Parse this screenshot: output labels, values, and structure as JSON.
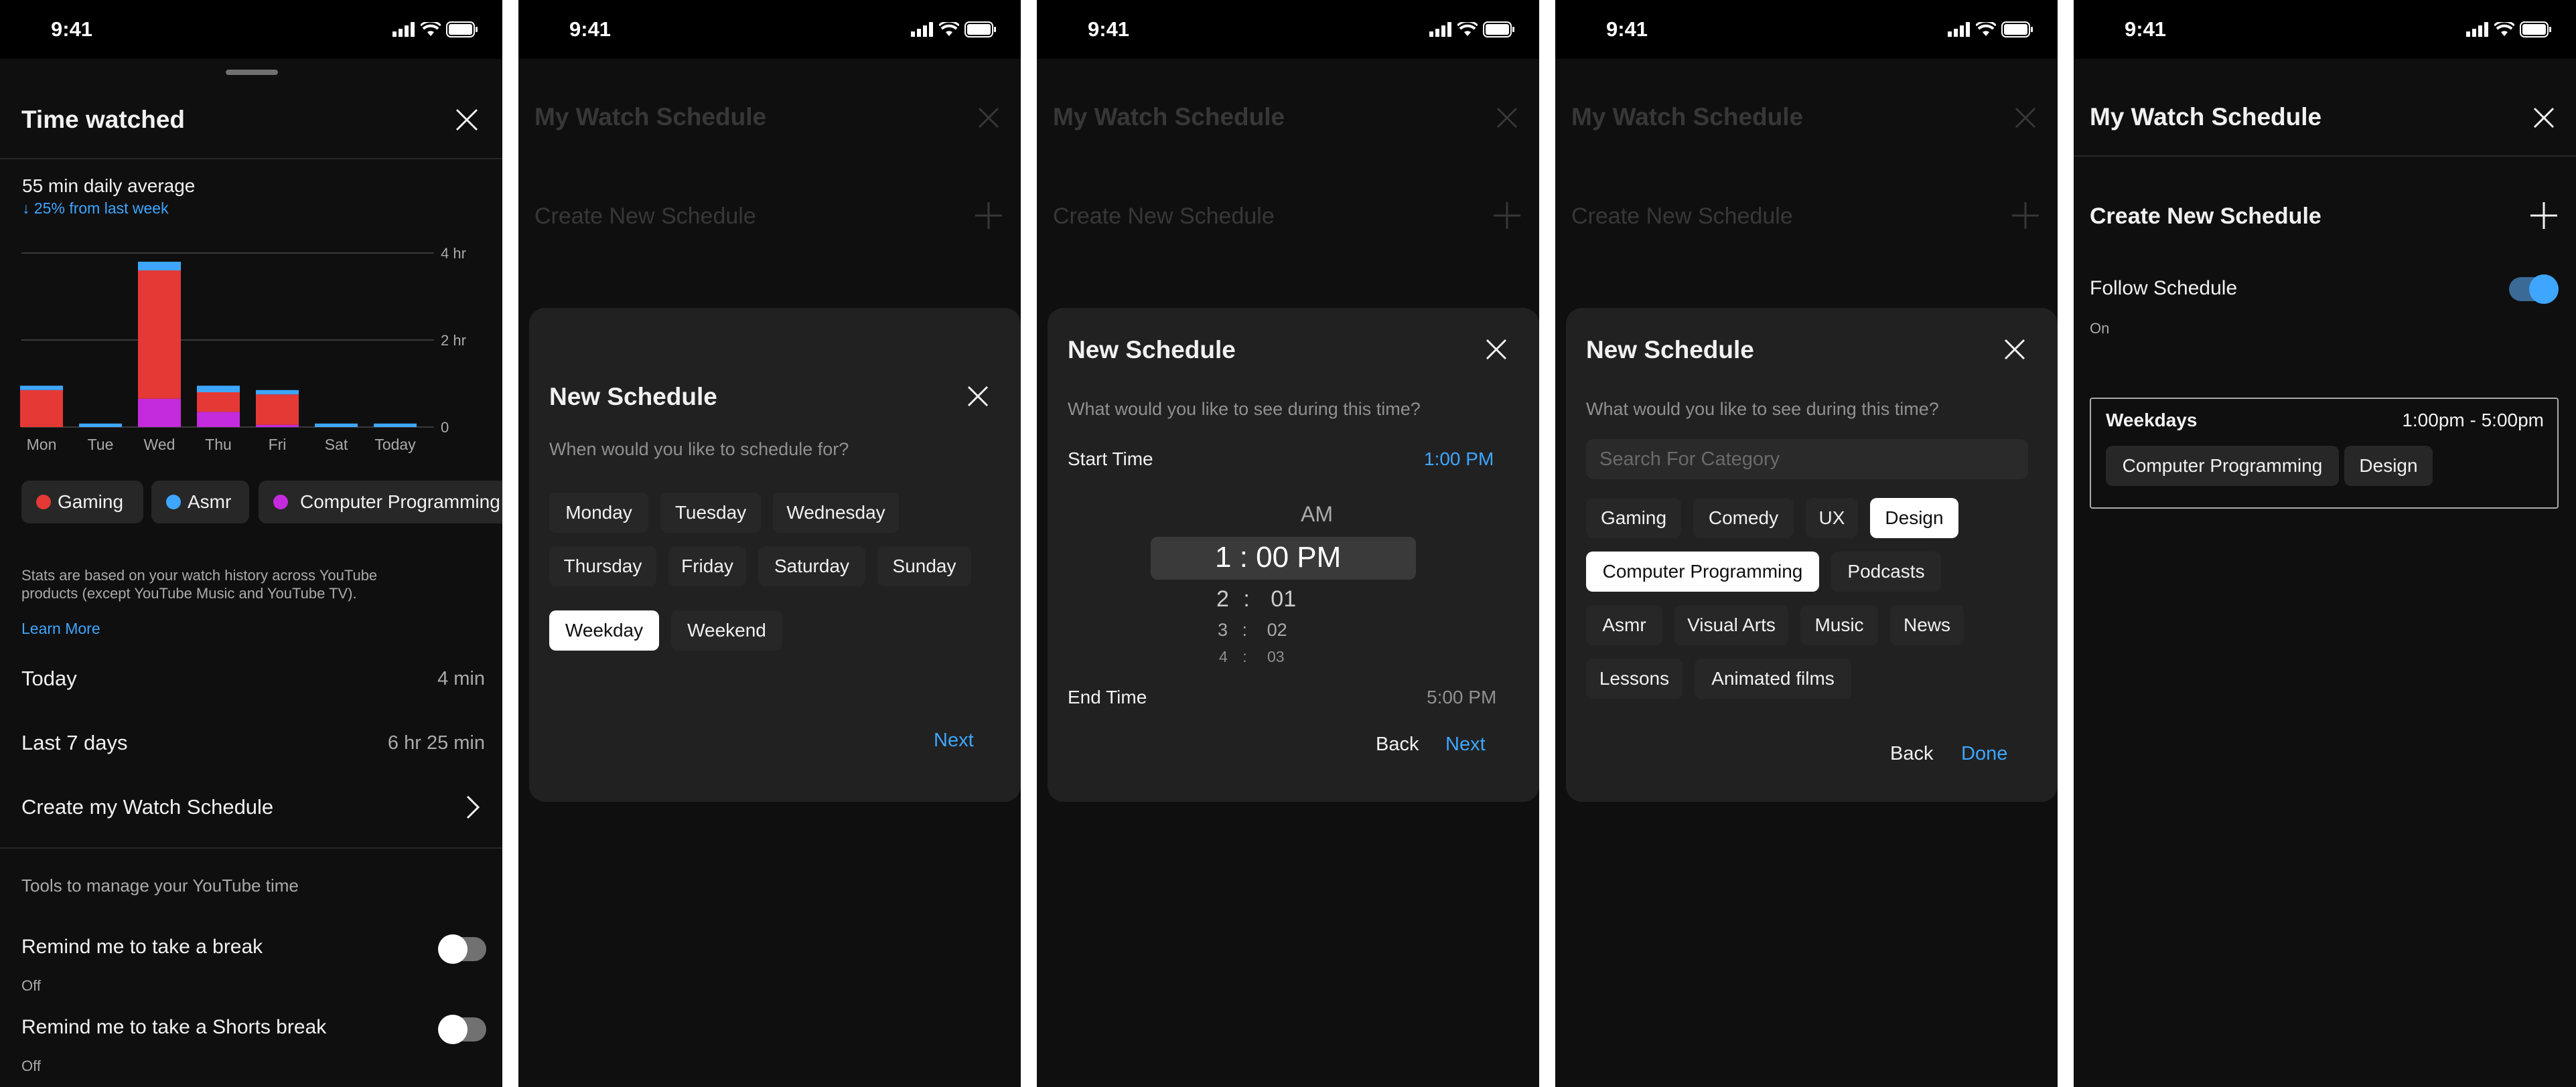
{
  "status_time": "9:41",
  "colors": {
    "accent": "#3ea6ff",
    "gaming": "#e53935",
    "asmr": "#3ea6ff",
    "programming": "#c42bdd"
  },
  "s1": {
    "title": "Time watched",
    "daily_average": "55 min daily average",
    "change": "↓ 25% from last week",
    "chart_data": {
      "type": "bar",
      "categories": [
        "Mon",
        "Tue",
        "Wed",
        "Thu",
        "Fri",
        "Sat",
        "Today"
      ],
      "y_ticks": [
        "4 hr",
        "2 hr",
        "0"
      ],
      "ylim": [
        0,
        4
      ],
      "series": [
        {
          "name": "Gaming",
          "values": [
            0.85,
            0,
            2.95,
            0.45,
            0.7,
            0,
            0
          ]
        },
        {
          "name": "Asmr",
          "values": [
            0.1,
            0.08,
            0.2,
            0.15,
            0.1,
            0.08,
            0.08
          ]
        },
        {
          "name": "Computer Programming",
          "values": [
            0,
            0,
            0.65,
            0.35,
            0.05,
            0,
            0
          ]
        }
      ]
    },
    "legend": [
      "Gaming",
      "Asmr",
      "Computer Programming"
    ],
    "stats_note": "Stats are based on your watch history across YouTube products (except YouTube Music and YouTube TV).",
    "learn_more": "Learn More",
    "rows": [
      {
        "label": "Today",
        "value": "4 min"
      },
      {
        "label": "Last 7 days",
        "value": "6 hr 25 min"
      }
    ],
    "create_link": "Create my Watch Schedule",
    "tools_header": "Tools to manage your YouTube time",
    "settings": [
      {
        "label": "Remind me to take a break",
        "state": "Off"
      },
      {
        "label": "Remind me to take a Shorts break",
        "state": "Off"
      }
    ]
  },
  "bg": {
    "title": "My Watch Schedule",
    "create": "Create New Schedule"
  },
  "s2": {
    "title": "New Schedule",
    "question": "When would you like to schedule for?",
    "days": [
      "Monday",
      "Tuesday",
      "Wednesday",
      "Thursday",
      "Friday",
      "Saturday",
      "Sunday"
    ],
    "groups": [
      "Weekday",
      "Weekend"
    ],
    "selected_group": "Weekday",
    "next": "Next"
  },
  "s3": {
    "title": "New Schedule",
    "question": "What would you like to see during this time?",
    "start_label": "Start Time",
    "start_value": "1:00 PM",
    "picker": {
      "ampm": "AM",
      "selected": "1 : 00 PM",
      "rows": [
        {
          "h": "2",
          "m": "01"
        },
        {
          "h": "3",
          "m": "02"
        },
        {
          "h": "4",
          "m": "03"
        }
      ]
    },
    "end_label": "End Time",
    "end_value": "5:00 PM",
    "back": "Back",
    "next": "Next"
  },
  "s4": {
    "title": "New Schedule",
    "question": "What would you like to see during this time?",
    "search_placeholder": "Search For Category",
    "categories": [
      "Gaming",
      "Comedy",
      "UX",
      "Design",
      "Computer Programming",
      "Podcasts",
      "Asmr",
      "Visual Arts",
      "Music",
      "News",
      "Lessons",
      "Animated films"
    ],
    "selected": [
      "Design",
      "Computer Programming"
    ],
    "back": "Back",
    "done": "Done"
  },
  "s5": {
    "title": "My Watch Schedule",
    "create": "Create New Schedule",
    "follow_label": "Follow Schedule",
    "follow_state": "On",
    "card": {
      "days": "Weekdays",
      "time": "1:00pm - 5:00pm",
      "tags": [
        "Computer Programming",
        "Design"
      ]
    }
  }
}
